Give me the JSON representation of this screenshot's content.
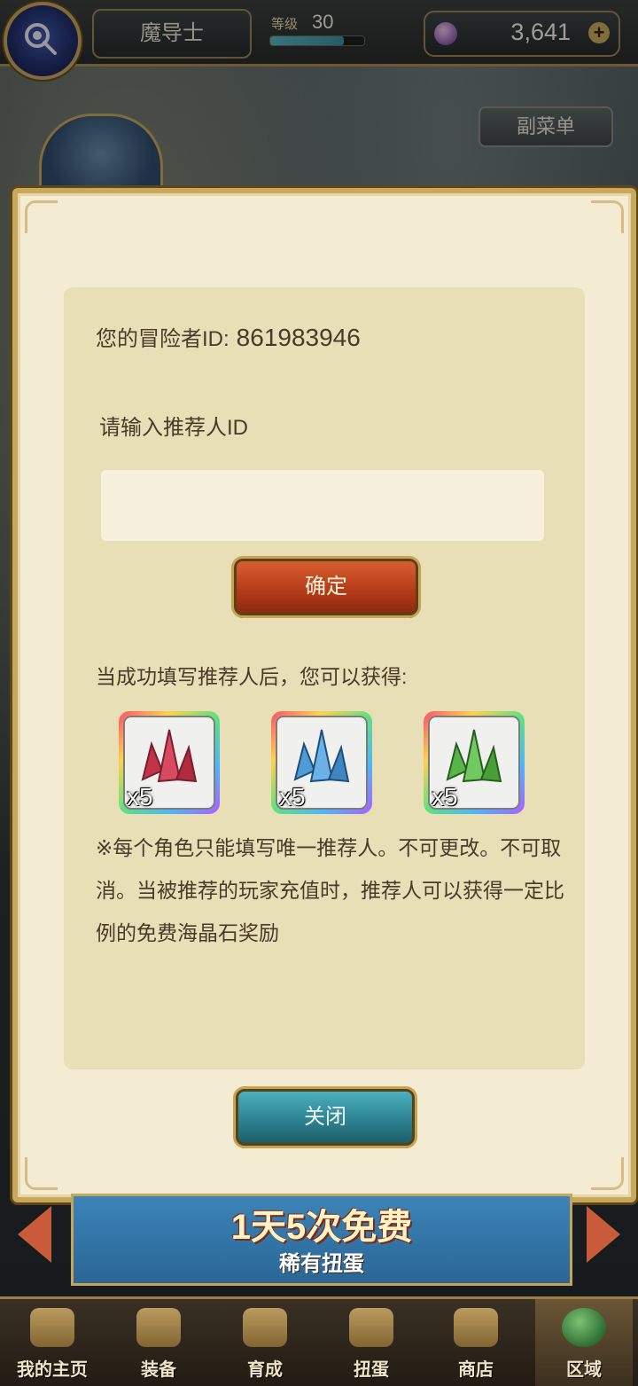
{
  "header": {
    "player_name": "魔导士",
    "level_label": "等级",
    "level_value": "30",
    "currency_value": "3,641",
    "plus_icon": "plus-icon"
  },
  "side": {
    "submenu_label": "副菜单"
  },
  "dialog": {
    "adventurer_id_label": "您的冒险者ID:",
    "adventurer_id_value": "861983946",
    "referrer_prompt": "请输入推荐人ID",
    "referrer_input_value": "",
    "confirm_label": "确定",
    "reward_intro": "当成功填写推荐人后，您可以获得:",
    "rewards": [
      {
        "name": "red-crystal-icon",
        "quantity": "x5",
        "color": "#c2334a"
      },
      {
        "name": "blue-crystal-icon",
        "quantity": "x5",
        "color": "#4f9bd8"
      },
      {
        "name": "green-crystal-icon",
        "quantity": "x5",
        "color": "#59b548"
      }
    ],
    "note": "※每个角色只能填写唯一推荐人。不可更改。不可取消。当被推荐的玩家充值时，推荐人可以获得一定比例的免费海晶石奖励",
    "close_label": "关闭"
  },
  "banner": {
    "title": "1天5次免费",
    "subtitle": "稀有扭蛋"
  },
  "nav": [
    {
      "label": "我的主页",
      "icon": "home-scroll-icon"
    },
    {
      "label": "装备",
      "icon": "helmet-icon"
    },
    {
      "label": "育成",
      "icon": "sword-icon"
    },
    {
      "label": "扭蛋",
      "icon": "gacha-icon"
    },
    {
      "label": "商店",
      "icon": "shop-bag-icon"
    },
    {
      "label": "区域",
      "icon": "globe-icon"
    }
  ],
  "colors": {
    "dialog_bg": "#f4ecd2",
    "confirm_button": "#c4451f",
    "close_button": "#2f8797",
    "gold_border": "#c8a85c"
  }
}
